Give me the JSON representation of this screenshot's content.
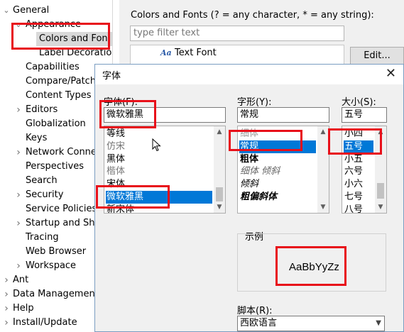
{
  "tree": {
    "items": [
      {
        "label": "General",
        "arrow": "v",
        "indent": 0
      },
      {
        "label": "Appearance",
        "arrow": "v",
        "indent": 1
      },
      {
        "label": "Colors and Fon",
        "arrow": "",
        "indent": 2,
        "selected": true
      },
      {
        "label": "Label Decoratio",
        "arrow": "",
        "indent": 2
      },
      {
        "label": "Capabilities",
        "arrow": "",
        "indent": 1
      },
      {
        "label": "Compare/Patch",
        "arrow": "",
        "indent": 1
      },
      {
        "label": "Content Types",
        "arrow": "",
        "indent": 1
      },
      {
        "label": "Editors",
        "arrow": ">",
        "indent": 1
      },
      {
        "label": "Globalization",
        "arrow": "",
        "indent": 1
      },
      {
        "label": "Keys",
        "arrow": "",
        "indent": 1
      },
      {
        "label": "Network Connec",
        "arrow": ">",
        "indent": 1
      },
      {
        "label": "Perspectives",
        "arrow": "",
        "indent": 1
      },
      {
        "label": "Search",
        "arrow": "",
        "indent": 1
      },
      {
        "label": "Security",
        "arrow": ">",
        "indent": 1
      },
      {
        "label": "Service Policies",
        "arrow": "",
        "indent": 1
      },
      {
        "label": "Startup and Shut",
        "arrow": ">",
        "indent": 1
      },
      {
        "label": "Tracing",
        "arrow": "",
        "indent": 1
      },
      {
        "label": "Web Browser",
        "arrow": "",
        "indent": 1
      },
      {
        "label": "Workspace",
        "arrow": ">",
        "indent": 1
      },
      {
        "label": "Ant",
        "arrow": ">",
        "indent": 0
      },
      {
        "label": "Data Management",
        "arrow": ">",
        "indent": 0
      },
      {
        "label": "Help",
        "arrow": ">",
        "indent": 0
      },
      {
        "label": "Install/Update",
        "arrow": ">",
        "indent": 0
      }
    ]
  },
  "pref": {
    "title": "Colors and Fonts (? = any character, * = any string):",
    "filter_placeholder": "type filter text",
    "list_icon": "Aa",
    "list_item": "Text Font",
    "edit_button": "Edit..."
  },
  "dialog": {
    "title": "字体",
    "font_label": "字体(F):",
    "font_value": "微软雅黑",
    "font_list": [
      "等线",
      "仿宋",
      "黑体",
      "楷体",
      "宋体",
      "微软雅黑",
      "新宋体"
    ],
    "font_selected_index": 5,
    "style_label": "字形(Y):",
    "style_value": "常规",
    "style_list": [
      "细体",
      "常规",
      "粗体",
      "细体 倾斜",
      "倾斜",
      "粗偏斜体"
    ],
    "style_selected_index": 1,
    "size_label": "大小(S):",
    "size_value": "五号",
    "size_list": [
      "小四",
      "五号",
      "小五",
      "六号",
      "小六",
      "七号",
      "八号"
    ],
    "size_selected_index": 1,
    "sample_label": "示例",
    "sample_text": "AaBbYyZz",
    "script_label": "脚本(R):",
    "script_value": "西欧语言"
  },
  "colors": {
    "selection": "#0078d7",
    "highlight": "#e8101a"
  }
}
